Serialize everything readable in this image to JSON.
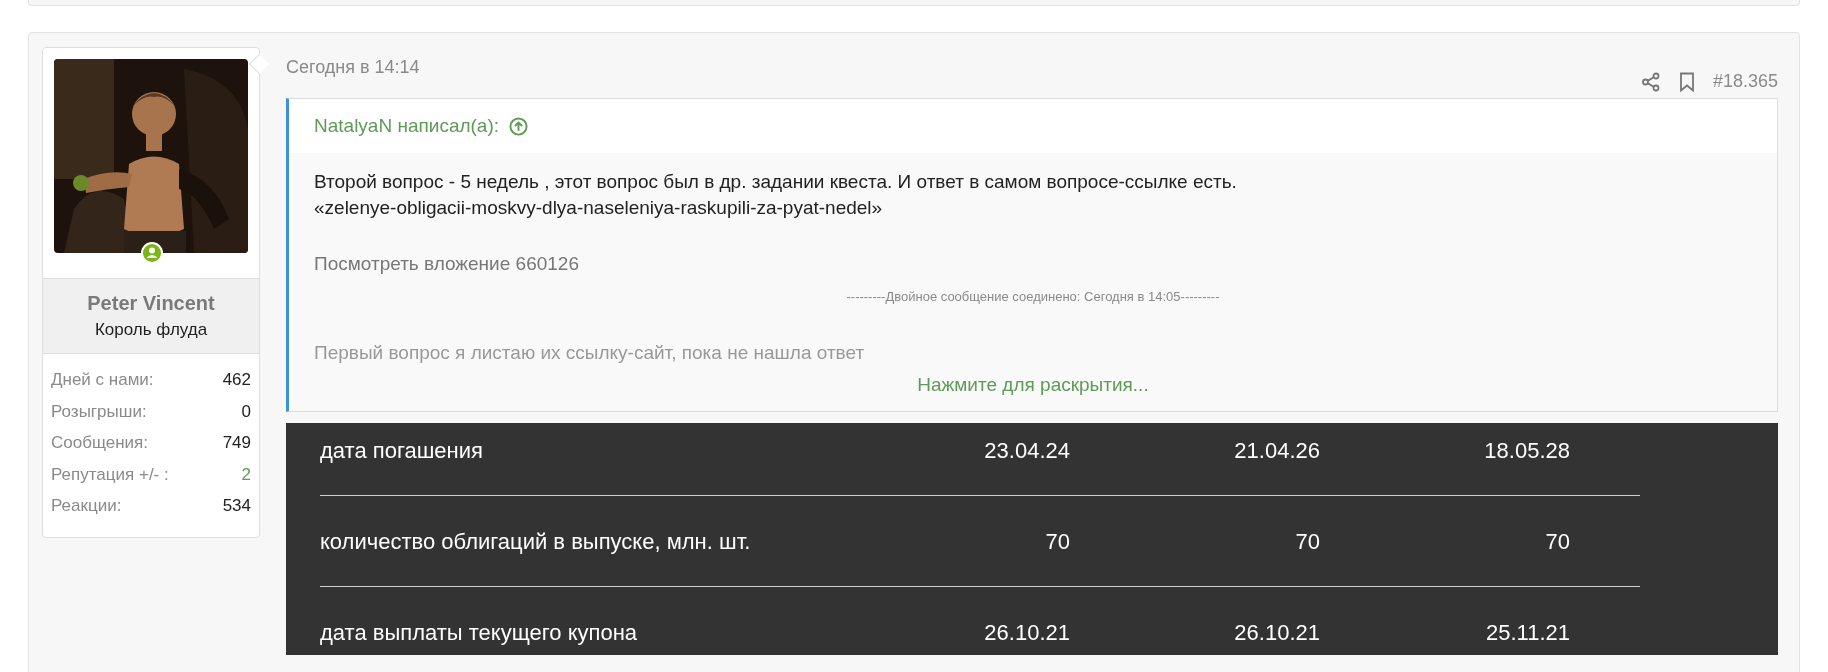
{
  "user": {
    "name": "Peter Vincent",
    "title": "Король флуда",
    "online": true,
    "stats": [
      {
        "label": "Дней с нами:",
        "value": "462",
        "kind": "count"
      },
      {
        "label": "Розыгрыши:",
        "value": "0",
        "kind": "count"
      },
      {
        "label": "Сообщения:",
        "value": "749",
        "kind": "count"
      },
      {
        "label": "Репутация +/- :",
        "value": "2",
        "kind": "reputation"
      },
      {
        "label": "Реакции:",
        "value": "534",
        "kind": "count"
      }
    ]
  },
  "post": {
    "timestamp": "Сегодня в 14:14",
    "number": "#18.365"
  },
  "quote": {
    "author": "NatalyaN написал(а):",
    "lines": [
      "Второй вопрос - 5 недель , этот вопрос был в др. задании квеста. И ответ в самом вопросе-ссылке есть.",
      "«zelenye-obligacii-moskvy-dlya-naseleniya-raskupili-za-pyat-nedel»"
    ],
    "attachment": "Посмотреть вложение 660126",
    "merged_notice": "---------Двойное сообщение соединено: Сегодня в 14:05---------",
    "faded_line": "Первый вопрос я листаю их ссылку-сайт, пока не нашла ответ",
    "expand": "Нажмите для раскрытия..."
  },
  "table": {
    "rows": [
      {
        "label": "дата погашения",
        "values": [
          "23.04.24",
          "21.04.26",
          "18.05.28"
        ]
      },
      {
        "label": "количество облигаций в выпуске, млн. шт.",
        "values": [
          "70",
          "70",
          "70"
        ]
      },
      {
        "label": "дата выплаты текущего купона",
        "values": [
          "26.10.21",
          "26.10.21",
          "25.11.21"
        ]
      }
    ]
  }
}
